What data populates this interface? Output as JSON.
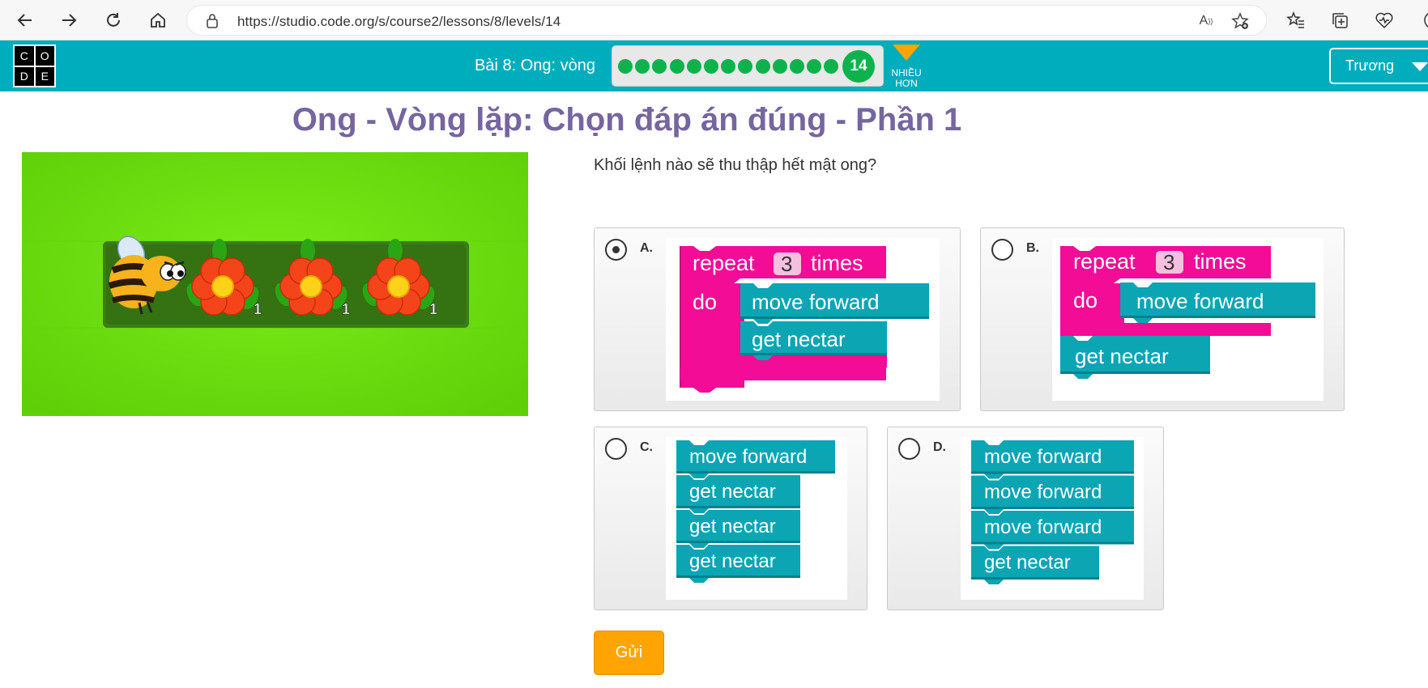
{
  "browser": {
    "url": "https://studio.code.org/s/course2/lessons/8/levels/14"
  },
  "header": {
    "logo_letters": [
      "C",
      "O",
      "D",
      "E"
    ],
    "lesson_title": "Bài 8: Ong: vòng",
    "progress": {
      "completed_dots": 13,
      "current_level": "14"
    },
    "more_label_line1": "NHIỀU",
    "more_label_line2": "HƠN",
    "user_name": "Trương"
  },
  "page": {
    "title": "Ong - Vòng lặp: Chọn đáp án đúng - Phần 1",
    "question": "Khối lệnh nào sẽ thu thập hết mật ong?",
    "submit_label": "Gửi"
  },
  "game": {
    "flower_counts": [
      "1",
      "1",
      "1"
    ]
  },
  "options": [
    {
      "letter": "A.",
      "selected": true,
      "repeat_label": "repeat",
      "repeat_count": "3",
      "times_label": "times",
      "do_label": "do",
      "inner_blocks": [
        "move forward",
        "get nectar"
      ],
      "after_blocks": []
    },
    {
      "letter": "B.",
      "selected": false,
      "repeat_label": "repeat",
      "repeat_count": "3",
      "times_label": "times",
      "do_label": "do",
      "inner_blocks": [
        "move forward"
      ],
      "after_blocks": [
        "get nectar"
      ]
    },
    {
      "letter": "C.",
      "selected": false,
      "blocks": [
        "move forward",
        "get nectar",
        "get nectar",
        "get nectar"
      ]
    },
    {
      "letter": "D.",
      "selected": false,
      "blocks": [
        "move forward",
        "move forward",
        "move forward",
        "get nectar"
      ]
    }
  ],
  "colors": {
    "header_teal": "#00adbc",
    "loop_pink": "#f20c96",
    "action_teal": "#0ba5b4",
    "title_purple": "#7665a0",
    "progress_green": "#0eb24c",
    "submit_orange": "#ffa400",
    "grass_green": "#6fe210"
  }
}
